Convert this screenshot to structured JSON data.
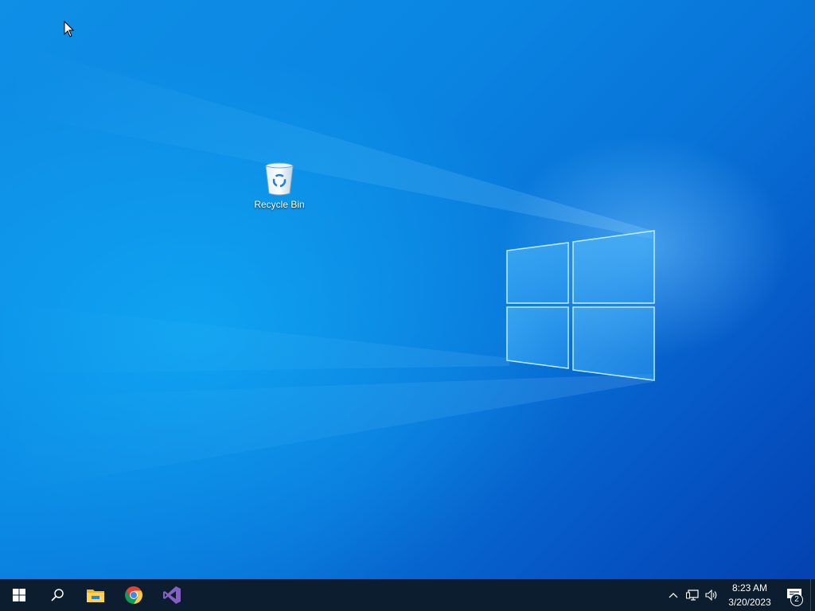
{
  "desktop": {
    "wallpaper_colors": {
      "top_left": "#0f8fe6",
      "bottom_right": "#0442b0",
      "glow": "#78c8ff"
    },
    "icons": [
      {
        "label": "Recycle Bin",
        "icon": "recycle-bin-icon"
      }
    ]
  },
  "taskbar": {
    "background": "#0b1d2e",
    "pinned": [
      {
        "name": "start",
        "icon": "windows-logo-icon"
      },
      {
        "name": "search",
        "icon": "search-icon"
      },
      {
        "name": "file-explorer",
        "icon": "folder-icon"
      },
      {
        "name": "chrome",
        "icon": "chrome-icon"
      },
      {
        "name": "visual-studio",
        "icon": "visual-studio-icon"
      }
    ],
    "tray": {
      "icons": [
        "chevron-up-icon",
        "network-icon",
        "volume-icon"
      ],
      "time": "8:23 AM",
      "date": "3/20/2023",
      "notification_count": "2"
    }
  }
}
